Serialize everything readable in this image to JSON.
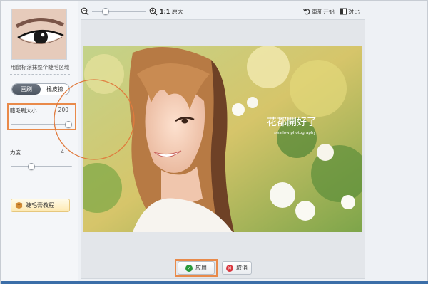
{
  "left_panel": {
    "hint": "用鼠标涂抹整个睫毛区域",
    "modes": [
      "画刷",
      "橡皮擦"
    ],
    "active_mode": 0,
    "brush_size_label": "睫毛刷大小",
    "brush_size_value": "200",
    "brush_size_level": 1.0,
    "strength_label": "力度",
    "strength_value": "4",
    "strength_level": 0.35,
    "tutorial_label": "睫毛膏教程"
  },
  "toolbar": {
    "zoom_level": 0.12,
    "ratio_value": "1:1",
    "ratio_text": "原大",
    "reset_label": "重新开始",
    "compare_label": "对比"
  },
  "photo": {
    "watermark_title": "花都開好了",
    "watermark_sub": "swallow photography"
  },
  "actions": {
    "apply_label": "应用",
    "cancel_label": "取消"
  },
  "colors": {
    "highlight": "#e98a4a",
    "apply_icon": "#2a9a3c",
    "cancel_icon": "#d9363e"
  }
}
